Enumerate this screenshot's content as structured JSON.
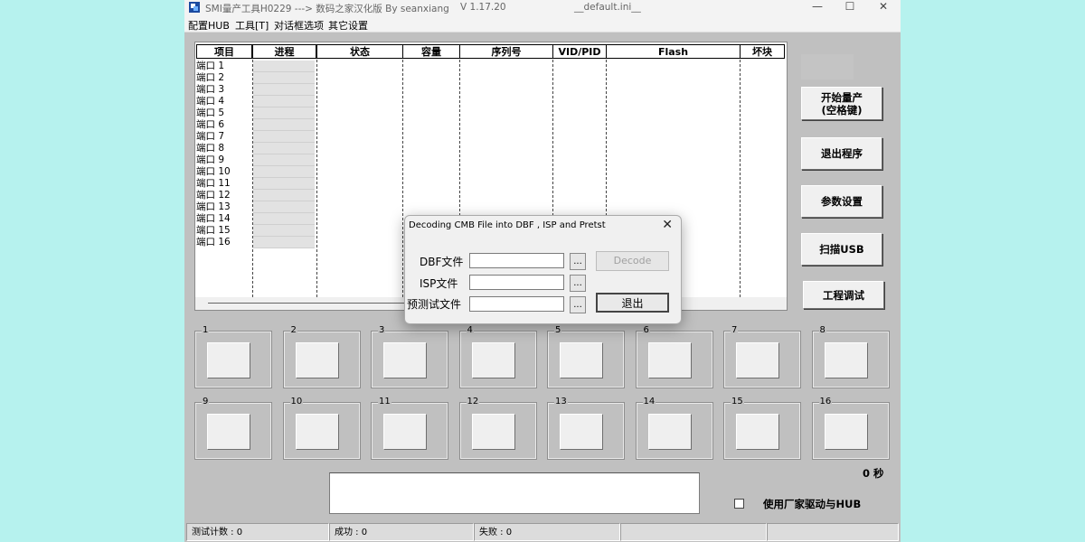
{
  "window": {
    "title": "SMI量产工具H0229 ---> 数码之家汉化版 By seanxiang",
    "version": "V 1.17.20",
    "ini": "__default.ini__",
    "controls": {
      "minimize": "—",
      "maximize": "☐",
      "close": "✕"
    }
  },
  "menu": [
    "配置HUB",
    "工具[T]",
    "对话框选项",
    "其它设置"
  ],
  "grid": {
    "headers": [
      "项目",
      "进程",
      "状态",
      "容量",
      "序列号",
      "VID/PID",
      "Flash",
      "坏块"
    ],
    "rows": [
      "端口 1",
      "端口 2",
      "端口 3",
      "端口 4",
      "端口 5",
      "端口 6",
      "端口 7",
      "端口 8",
      "端口 9",
      "端口 10",
      "端口 11",
      "端口 12",
      "端口 13",
      "端口 14",
      "端口 15",
      "端口 16"
    ]
  },
  "side_buttons": {
    "start": "开始量产\n(空格键)",
    "exit": "退出程序",
    "settings": "参数设置",
    "scan": "扫描USB",
    "debug": "工程调试"
  },
  "ports": [
    "1",
    "2",
    "3",
    "4",
    "5",
    "6",
    "7",
    "8",
    "9",
    "10",
    "11",
    "12",
    "13",
    "14",
    "15",
    "16"
  ],
  "timer": "0 秒",
  "vendor_driver": {
    "label": "使用厂家驱动与HUB",
    "checked": false
  },
  "status": {
    "test_count": "测试计数 : 0",
    "success": "成功 : 0",
    "fail": "失败 : 0"
  },
  "dialog": {
    "title": "Decoding CMB File into DBF , ISP and Pretst",
    "close": "✕",
    "fields": [
      {
        "label": "DBF文件",
        "value": ""
      },
      {
        "label": "ISP文件",
        "value": ""
      },
      {
        "label": "预测试文件",
        "value": ""
      }
    ],
    "browse": "...",
    "decode": "Decode",
    "exit": "退出"
  },
  "colors": {
    "desktop": "#b6f2ee",
    "window_bg": "#c0c0c0",
    "progress_cell": "#e2e2e2"
  }
}
